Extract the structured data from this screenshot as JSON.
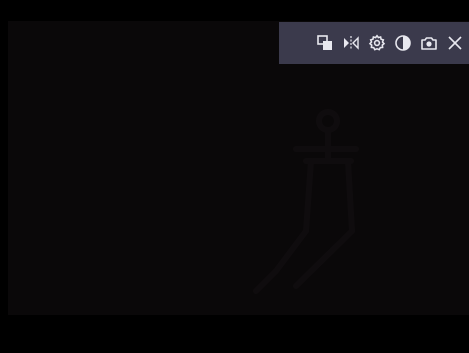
{
  "window": {
    "background_color": "#000000",
    "video_background_color": "#0a0809"
  },
  "toolbar": {
    "background_color": "#3b3a4c",
    "icon_color": "#e8e8ef",
    "buttons": [
      {
        "icon": "picture-in-picture-icon"
      },
      {
        "icon": "flip-horizontal-icon"
      },
      {
        "icon": "gear-icon"
      },
      {
        "icon": "contrast-icon"
      },
      {
        "icon": "camera-icon"
      },
      {
        "icon": "close-icon"
      }
    ]
  }
}
